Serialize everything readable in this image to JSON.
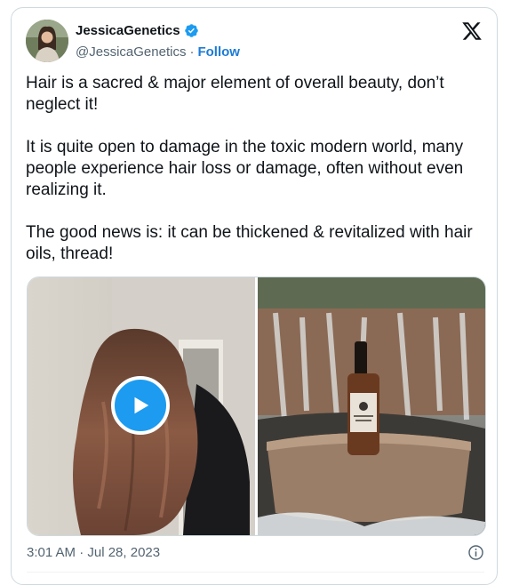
{
  "author": {
    "display_name": "JessicaGenetics",
    "handle": "@JessicaGenetics",
    "separator": "·",
    "follow_label": "Follow"
  },
  "tweet": {
    "text": "Hair is a sacred & major element of overall beauty, don’t neglect it!\n\nIt is quite open to damage in the toxic modern world, many people experience hair loss or damage, often without even realizing it.\n\nThe good news is: it can be thickened & revitalized with hair oils, thread!",
    "timestamp": "3:01 AM · Jul 28, 2023"
  },
  "colors": {
    "accent": "#1d9bf0",
    "follow": "#1d7bd6",
    "text": "#0f1419",
    "muted": "#536471"
  },
  "icons": {
    "verified": "verified-badge-icon",
    "platform": "x-logo-icon",
    "play": "play-icon",
    "info": "info-icon"
  }
}
